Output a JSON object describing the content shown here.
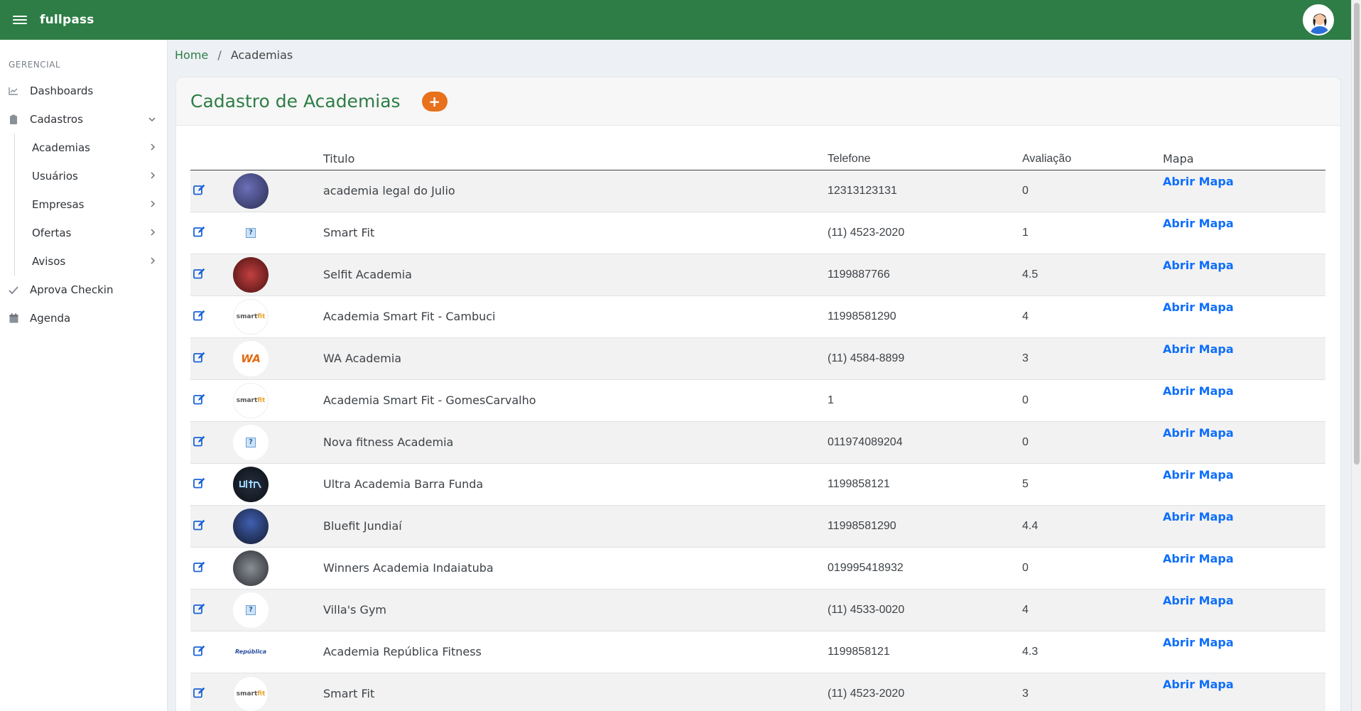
{
  "app": {
    "brand": "fullpass"
  },
  "sidebar": {
    "section": "GERENCIAL",
    "items": [
      {
        "label": "Dashboards",
        "icon": "chart-line-icon"
      },
      {
        "label": "Cadastros",
        "icon": "clipboard-icon",
        "expanded": true
      }
    ],
    "sub_items": [
      {
        "label": "Academias"
      },
      {
        "label": "Usuários"
      },
      {
        "label": "Empresas"
      },
      {
        "label": "Ofertas"
      },
      {
        "label": "Avisos"
      }
    ],
    "bottom_items": [
      {
        "label": "Aprova Checkin",
        "icon": "check-icon"
      },
      {
        "label": "Agenda",
        "icon": "calendar-icon"
      }
    ]
  },
  "breadcrumb": {
    "home": "Home",
    "current": "Academias"
  },
  "page": {
    "title": "Cadastro de Academias",
    "add_label": "+"
  },
  "table": {
    "headers": {
      "titulo": "Titulo",
      "telefone": "Telefone",
      "avaliacao": "Avaliação",
      "mapa": "Mapa"
    },
    "map_label": "Abrir Mapa",
    "rows": [
      {
        "titulo": "academia legal do Julio",
        "telefone": "12313123131",
        "avaliacao": "0",
        "thumb": "photo"
      },
      {
        "titulo": "Smart Fit",
        "telefone": "(11) 4523-2020",
        "avaliacao": "1",
        "thumb": "broken"
      },
      {
        "titulo": "Selfit Academia",
        "telefone": "1199887766",
        "avaliacao": "4.5",
        "thumb": "red"
      },
      {
        "titulo": "Academia Smart Fit - Cambuci",
        "telefone": "11998581290",
        "avaliacao": "4",
        "thumb": "smart"
      },
      {
        "titulo": "WA Academia",
        "telefone": "(11) 4584-8899",
        "avaliacao": "3",
        "thumb": "wa"
      },
      {
        "titulo": "Academia Smart Fit - GomesCarvalho",
        "telefone": "1",
        "avaliacao": "0",
        "thumb": "smart"
      },
      {
        "titulo": "Nova fitness Academia",
        "telefone": "011974089204",
        "avaliacao": "0",
        "thumb": "broken"
      },
      {
        "titulo": "Ultra Academia Barra Funda",
        "telefone": "1199858121",
        "avaliacao": "5",
        "thumb": "dark"
      },
      {
        "titulo": "Bluefit Jundiaí",
        "telefone": "11998581290",
        "avaliacao": "4.4",
        "thumb": "blue"
      },
      {
        "titulo": "Winners Academia Indaiatuba",
        "telefone": "019995418932",
        "avaliacao": "0",
        "thumb": "gray"
      },
      {
        "titulo": "Villa's Gym",
        "telefone": "(11) 4533-0020",
        "avaliacao": "4",
        "thumb": "broken"
      },
      {
        "titulo": "Academia República Fitness",
        "telefone": "1199858121",
        "avaliacao": "4.3",
        "thumb": "rep"
      },
      {
        "titulo": "Smart Fit",
        "telefone": "(11) 4523-2020",
        "avaliacao": "3",
        "thumb": "smart"
      }
    ]
  },
  "colors": {
    "brand": "#2e7d46",
    "accent": "#e8711c",
    "link": "#0d6efd"
  }
}
